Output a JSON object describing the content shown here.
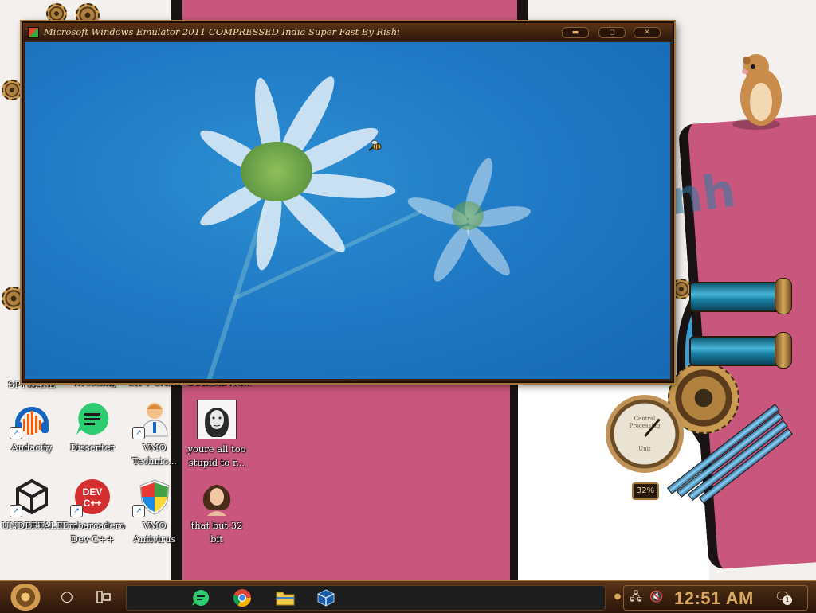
{
  "window": {
    "title": "Microsoft Windows Emulator 2011 COMPRESSED India Super Fast By Rishi",
    "controls": [
      "minimize",
      "maximize",
      "close"
    ]
  },
  "desktop_icons": [
    {
      "label": "THE SPYWARE",
      "icon": "spyware-icon"
    },
    {
      "label": "Wrestling",
      "icon": "wrestling-icon"
    },
    {
      "label": "GIFT CAR...",
      "icon": "gift-card-icon"
    },
    {
      "label": "COLLABVM...",
      "icon": "collabvm-icon"
    },
    {
      "label": "Audacity",
      "icon": "audacity-icon"
    },
    {
      "label": "Dissenter",
      "icon": "dissenter-icon"
    },
    {
      "label": "VMO Technic...",
      "icon": "vmo-technician-icon"
    },
    {
      "label": "youre all too stupid to r...",
      "icon": "portrait-icon"
    },
    {
      "label": "UNDERTALE",
      "icon": "unity-icon"
    },
    {
      "label": "Embarcadero Dev-C++",
      "icon": "devcpp-icon"
    },
    {
      "label": "VMO Antivirus",
      "icon": "shield-icon"
    },
    {
      "label": "that but 32 bit",
      "icon": "portrait-lady-icon"
    }
  ],
  "gauge": {
    "caption_top": "Central",
    "caption_mid": "Processing",
    "caption_bottom": "Unit",
    "value": "32%"
  },
  "taskbar": {
    "start": "start-orb-icon",
    "search": "cortana-circle-icon",
    "task_view": "task-view-icon",
    "pinned": [
      "dissenter-icon",
      "chrome-icon",
      "file-explorer-icon",
      "virtualbox-icon"
    ],
    "tray_icons": [
      "network-icon",
      "volume-muted-icon"
    ],
    "clock": "12:51 AM",
    "notifications_count": "1"
  },
  "colors": {
    "wallpaper_pink": "#c9577d",
    "wallpaper_blue": "#3a9fd6",
    "window_frame": "#3b2212",
    "screen_blue": "#1f78c4",
    "clock_color": "#d8a95f"
  }
}
